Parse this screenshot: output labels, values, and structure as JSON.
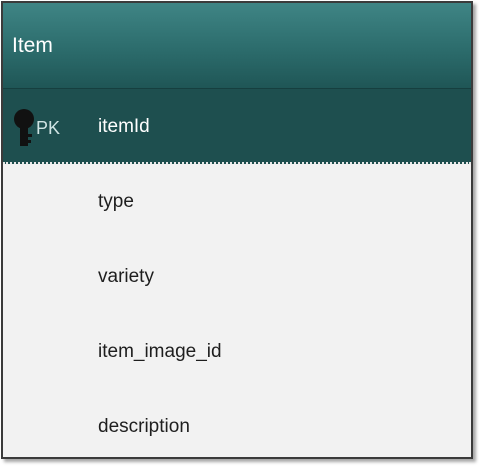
{
  "entity": {
    "title": "Item",
    "primary_key": {
      "badge": "PK",
      "name": "itemId",
      "icon": "key-icon"
    },
    "attributes": [
      {
        "name": "type"
      },
      {
        "name": "variety"
      },
      {
        "name": "item_image_id"
      },
      {
        "name": "description"
      }
    ]
  },
  "colors": {
    "header": "#2c6c6c",
    "pk_row": "#1e4f4f",
    "body": "#f2f2f2",
    "border": "#3b3b3b"
  }
}
